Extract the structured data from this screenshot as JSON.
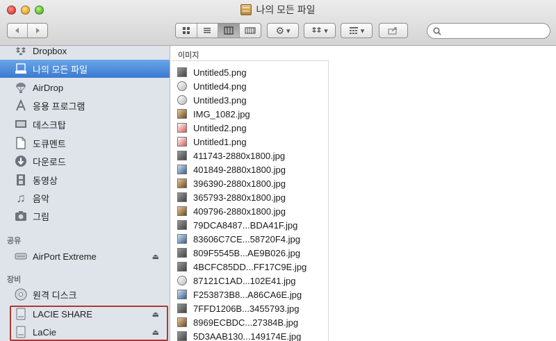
{
  "window": {
    "title": "나의 모든 파일",
    "title_icon": "drawer-icon"
  },
  "toolbar": {
    "back_icon": "chevron-left-icon",
    "forward_icon": "chevron-right-icon",
    "view_icons": [
      "icon-view-icon",
      "list-view-icon",
      "column-view-icon",
      "coverflow-view-icon"
    ],
    "active_view": "column-view-icon",
    "action_icon": "gear-icon",
    "dropbox_icon": "dropbox-icon",
    "arrange_icon": "arrange-icon",
    "share_icon": "share-icon",
    "dropdown_glyph": "▾",
    "search": {
      "value": "",
      "placeholder": ""
    }
  },
  "sidebar": {
    "favorites": [
      {
        "label": "Dropbox",
        "icon": "dropbox-icon"
      },
      {
        "label": "나의 모든 파일",
        "icon": "all-files-icon",
        "selected": true
      },
      {
        "label": "AirDrop",
        "icon": "airdrop-icon"
      },
      {
        "label": "응용 프로그램",
        "icon": "applications-icon"
      },
      {
        "label": "데스크탑",
        "icon": "desktop-icon"
      },
      {
        "label": "도큐멘트",
        "icon": "documents-icon"
      },
      {
        "label": "다운로드",
        "icon": "downloads-icon"
      },
      {
        "label": "동영상",
        "icon": "movies-icon"
      },
      {
        "label": "음악",
        "icon": "music-icon"
      },
      {
        "label": "그림",
        "icon": "pictures-icon"
      }
    ],
    "shared_header": "공유",
    "shared": [
      {
        "label": "AirPort Extreme",
        "icon": "network-drive-icon",
        "eject": true
      }
    ],
    "devices_header": "장비",
    "devices": [
      {
        "label": "원격 디스크",
        "icon": "remote-disc-icon",
        "eject": false
      },
      {
        "label": "LACIE SHARE",
        "icon": "external-drive-icon",
        "eject": true
      },
      {
        "label": "LaCie",
        "icon": "external-drive-icon",
        "eject": true
      }
    ],
    "eject_glyph": "⏏"
  },
  "column": {
    "header": "이미지",
    "files": [
      {
        "name": "Untitled5.png",
        "thumb": "dark"
      },
      {
        "name": "Untitled4.png",
        "thumb": "light"
      },
      {
        "name": "Untitled3.png",
        "thumb": "light"
      },
      {
        "name": "IMG_1082.jpg",
        "thumb": "warm"
      },
      {
        "name": "Untitled2.png",
        "thumb": "red"
      },
      {
        "name": "Untitled1.png",
        "thumb": "red"
      },
      {
        "name": "411743-2880x1800.jpg",
        "thumb": "dark"
      },
      {
        "name": "401849-2880x1800.jpg",
        "thumb": "blue"
      },
      {
        "name": "396390-2880x1800.jpg",
        "thumb": "warm"
      },
      {
        "name": "365793-2880x1800.jpg",
        "thumb": "dark"
      },
      {
        "name": "409796-2880x1800.jpg",
        "thumb": "warm"
      },
      {
        "name": "79DCA8487...BDA41F.jpg",
        "thumb": "dark"
      },
      {
        "name": "83606C7CE...58720F4.jpg",
        "thumb": "blue"
      },
      {
        "name": "809F5545B...AE9B026.jpg",
        "thumb": "dark"
      },
      {
        "name": "4BCFC85DD...FF17C9E.jpg",
        "thumb": "dark"
      },
      {
        "name": "87121C1AD...102E41.jpg",
        "thumb": "light"
      },
      {
        "name": "F253873B8...A86CA6E.jpg",
        "thumb": "blue"
      },
      {
        "name": "7FFD1206B...3455793.jpg",
        "thumb": "dark"
      },
      {
        "name": "8969ECBDC...27384B.jpg",
        "thumb": "warm"
      },
      {
        "name": "5D3AAB130...149174E.jpg",
        "thumb": "dark"
      }
    ]
  },
  "colors": {
    "selection": "#3b79d0",
    "sidebar_bg": "#dfe4ea",
    "highlight_box": "#a93a35"
  }
}
